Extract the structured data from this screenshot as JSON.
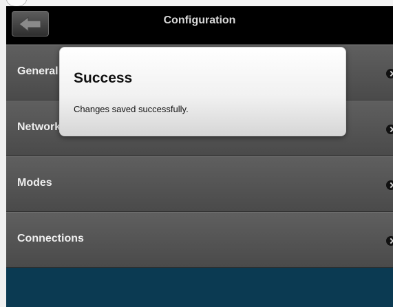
{
  "header": {
    "title": "Configuration",
    "back_icon": "arrow-left-icon"
  },
  "menu": {
    "items": [
      {
        "label": "General"
      },
      {
        "label": "Network"
      },
      {
        "label": "Modes"
      },
      {
        "label": "Connections"
      }
    ]
  },
  "dialog": {
    "title": "Success",
    "message": "Changes saved successfully."
  },
  "colors": {
    "titlebar": "#000000",
    "menu_item": "#555555",
    "footer": "#0b3a52",
    "dialog": "#f4f4f4"
  }
}
